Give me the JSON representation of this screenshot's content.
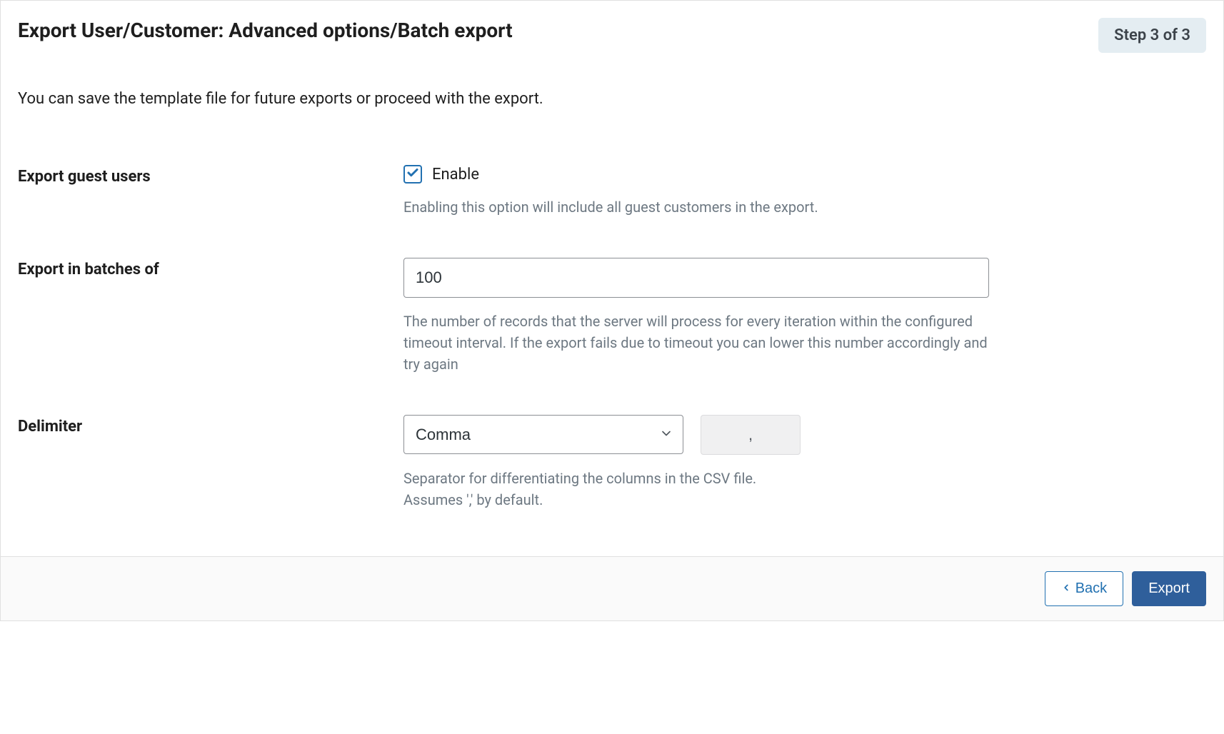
{
  "header": {
    "title": "Export User/Customer: Advanced options/Batch export",
    "step_label": "Step 3 of 3"
  },
  "intro": "You can save the template file for future exports or proceed with the export.",
  "form": {
    "guest_users": {
      "label": "Export guest users",
      "checkbox_label": "Enable",
      "checked": true,
      "help": "Enabling this option will include all guest customers in the export."
    },
    "batch": {
      "label": "Export in batches of",
      "value": "100",
      "help": "The number of records that the server will process for every iteration within the configured timeout interval. If the export fails due to timeout you can lower this number accordingly and try again"
    },
    "delimiter": {
      "label": "Delimiter",
      "selected": "Comma",
      "preview": ",",
      "help": "Separator for differentiating the columns in the CSV file. Assumes ',' by default."
    }
  },
  "footer": {
    "back_label": "Back",
    "export_label": "Export"
  }
}
